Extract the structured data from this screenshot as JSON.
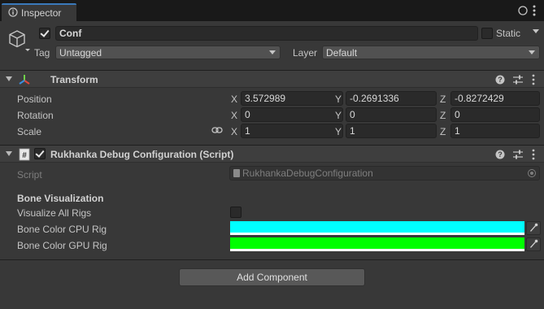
{
  "tab": {
    "title": "Inspector",
    "icon": "info-icon"
  },
  "window_icons": [
    "lock-icon",
    "kebab-menu-icon"
  ],
  "gameobject": {
    "icon": "cube-icon",
    "active": true,
    "name": "Conf",
    "static_label": "Static",
    "tag_label": "Tag",
    "tag_value": "Untagged",
    "layer_label": "Layer",
    "layer_value": "Default"
  },
  "transform": {
    "title": "Transform",
    "icon": "transform-axes-icon",
    "rows": [
      {
        "label": "Position",
        "x": "3.572989",
        "y": "-0.2691336",
        "z": "-0.8272429"
      },
      {
        "label": "Rotation",
        "x": "0",
        "y": "0",
        "z": "0"
      },
      {
        "label": "Scale",
        "x": "1",
        "y": "1",
        "z": "1"
      }
    ],
    "axis_labels": [
      "X",
      "Y",
      "Z"
    ],
    "scale_link_icon": "link-icon"
  },
  "script_component": {
    "title": "Rukhanka Debug Configuration (Script)",
    "icon": "script-hash-icon",
    "enabled": true,
    "script_label": "Script",
    "script_value": "RukhankaDebugConfiguration",
    "section_header": "Bone Visualization",
    "visualize_label": "Visualize All Rigs",
    "visualize_value": false,
    "cpu_label": "Bone Color CPU Rig",
    "cpu_color": "#00FFFF",
    "gpu_label": "Bone Color GPU Rig",
    "gpu_color": "#00FF00"
  },
  "header_tools": [
    "help-icon",
    "presets-sliders-icon",
    "kebab-menu-icon"
  ],
  "add_component_label": "Add Component"
}
